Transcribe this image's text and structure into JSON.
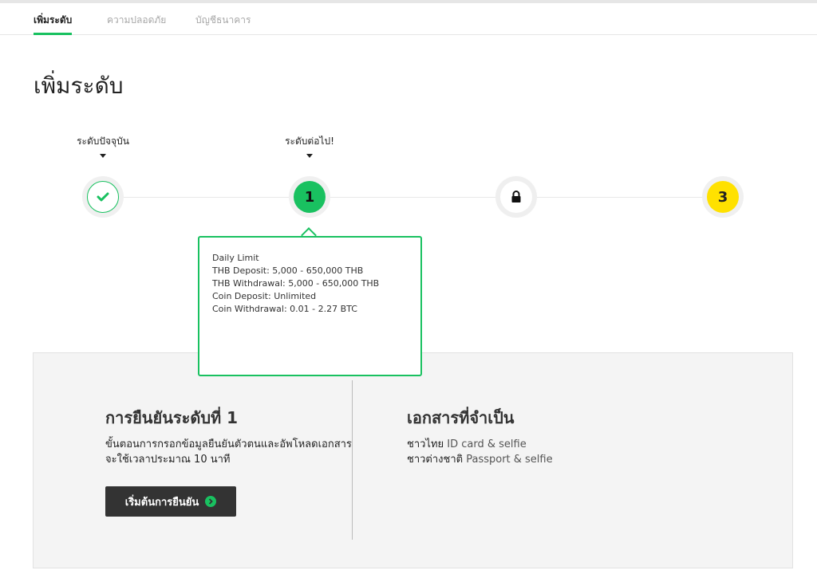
{
  "tabs": [
    {
      "label": "เพิ่มระดับ",
      "active": true
    },
    {
      "label": "ความปลอดภัย",
      "active": false
    },
    {
      "label": "บัญชีธนาคาร",
      "active": false
    }
  ],
  "page": {
    "title": "เพิ่มระดับ"
  },
  "progress": {
    "current_label": "ระดับปัจจุบัน",
    "next_label": "ระดับต่อไป!",
    "steps": [
      {
        "type": "done",
        "icon": "check-icon",
        "color": "#19c160"
      },
      {
        "type": "level",
        "label": "1",
        "color": "#19c160"
      },
      {
        "type": "locked",
        "icon": "lock-icon"
      },
      {
        "type": "level",
        "label": "3",
        "color": "#ffe100"
      }
    ]
  },
  "popup": {
    "lines": [
      "Daily Limit",
      "THB Deposit: 5,000 - 650,000 THB",
      "THB Withdrawal: 5,000 - 650,000 THB",
      "Coin Deposit: Unlimited",
      "Coin Withdrawal: 0.01 - 2.27 BTC"
    ]
  },
  "verify": {
    "title": "การยืนยันระดับที่ 1",
    "description": "ขั้นตอนการกรอกข้อมูลยืนยันตัวตนและอัพโหลดเอกสาร จะใช้เวลาประมาณ 10 นาที",
    "button_label": "เริ่มต้นการยืนยัน"
  },
  "documents": {
    "title": "เอกสารที่จำเป็น",
    "items": [
      {
        "who": "ชาวไทย",
        "doc": "ID card & selfie"
      },
      {
        "who": "ชาวต่างชาติ",
        "doc": "Passport & selfie"
      }
    ]
  },
  "colors": {
    "accent": "#19c160",
    "level3": "#ffe100",
    "button": "#333333"
  }
}
